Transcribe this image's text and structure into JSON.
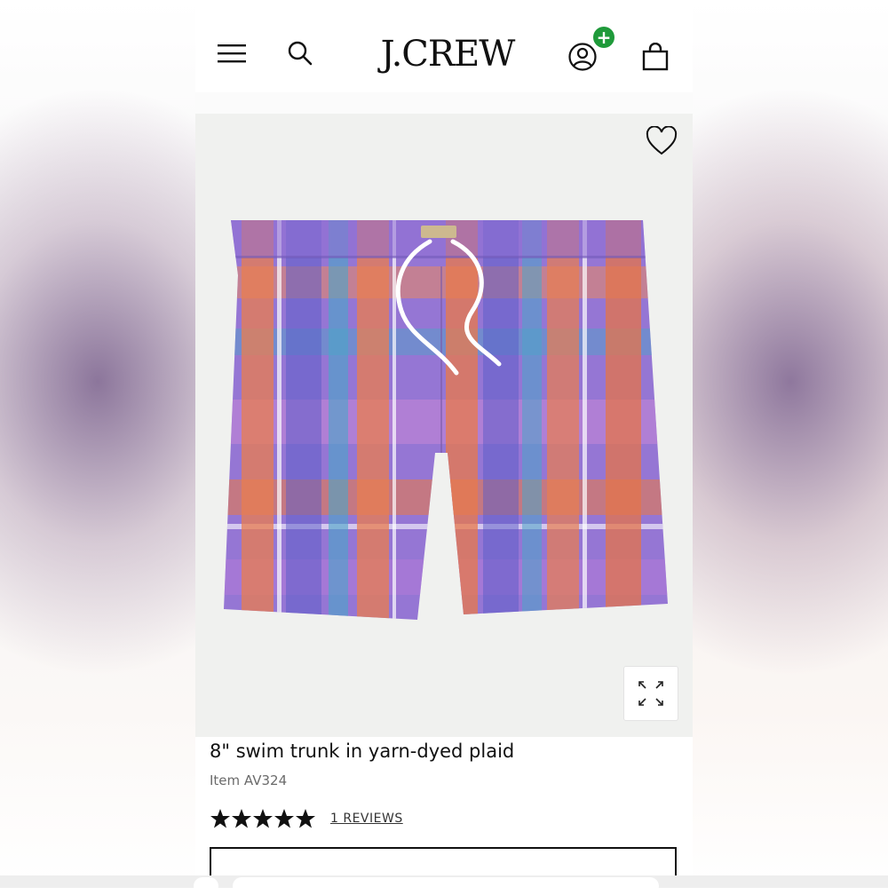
{
  "header": {
    "logo": "J.CREW",
    "menu_icon": "hamburger-menu-icon",
    "search_icon": "search-icon",
    "account_icon": "account-icon",
    "account_badge": "+",
    "bag_icon": "shopping-bag-icon"
  },
  "product": {
    "title": "8\" swim trunk in yarn-dyed plaid",
    "item_number": "Item AV324",
    "rating": 5,
    "rating_max": 5,
    "reviews_label": "1 REVIEWS",
    "image_subject": "plaid swim trunks",
    "wishlist_icon": "heart-icon",
    "expand_icon": "expand-icon"
  },
  "colors": {
    "badge_green": "#1f9a3a",
    "image_background": "#f0f1ef",
    "plaid_orange": "#e8774d",
    "plaid_purple": "#8a6fd0",
    "plaid_teal": "#3aa2bf"
  }
}
